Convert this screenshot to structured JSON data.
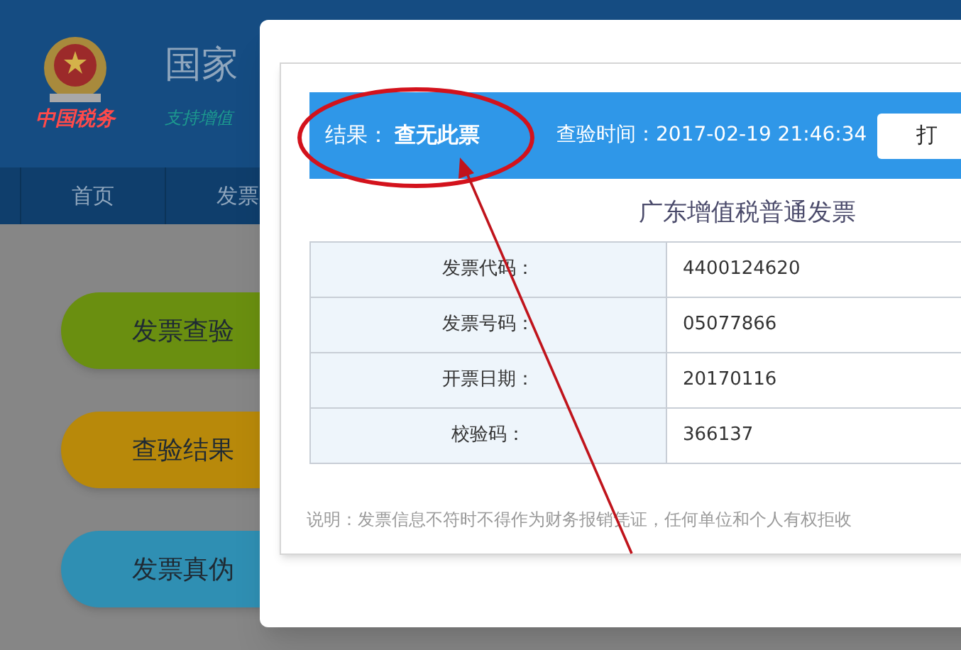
{
  "header": {
    "logo_text": "中国税务",
    "title": "国家",
    "subtitle": "支持增值"
  },
  "nav": [
    {
      "label": "首页",
      "selected": false
    },
    {
      "label": "发票",
      "selected": false
    }
  ],
  "guide_buttons": [
    {
      "label": "发票查验",
      "color": "#6a8f10"
    },
    {
      "label": "查验结果",
      "color": "#b8890a"
    },
    {
      "label": "发票真伪",
      "color": "#2f8fb3"
    }
  ],
  "dialog": {
    "result_label": "结果：",
    "result_value": "查无此票",
    "time_label": "查验时间：2017-02-19 21:46:34",
    "print_button": "打",
    "invoice_title": "广东增值税普通发票",
    "rows": [
      {
        "label": "发票代码：",
        "value": "4400124620"
      },
      {
        "label": "发票号码：",
        "value": "05077866"
      },
      {
        "label": "开票日期：",
        "value": "20170116"
      },
      {
        "label": "校验码：",
        "value": "366137"
      }
    ],
    "note": "说明：发票信息不符时不得作为财务报销凭证，任何单位和个人有权拒收"
  }
}
